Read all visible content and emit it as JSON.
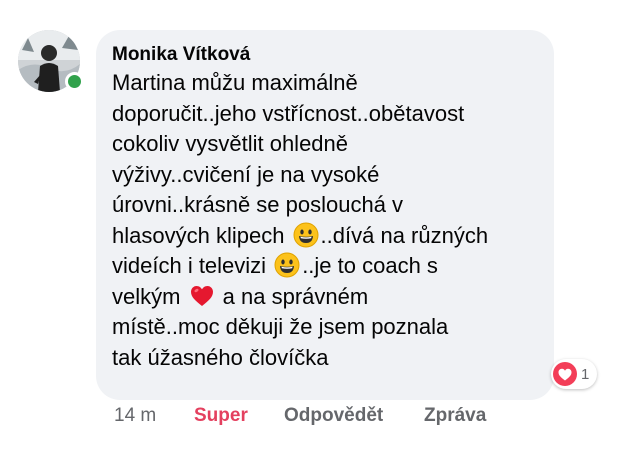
{
  "comment": {
    "author": "Monika Vítková",
    "online": true,
    "body_lines": [
      {
        "text": "Martina můžu maximálně"
      },
      {
        "text": "doporučit..jeho vstřícnost..obětavost"
      },
      {
        "text": "cokoliv vysvětlit ohledně"
      },
      {
        "text": "výživy..cvičení je na vysoké"
      },
      {
        "text": "úrovni..krásně se poslouchá v"
      },
      {
        "before": "hlasových klipech ",
        "emoji": "grinning-face-icon",
        "after": "..dívá na různých"
      },
      {
        "before": "videích i televizi ",
        "emoji": "grinning-face-icon",
        "after": "..je to coach s"
      },
      {
        "before": "velkým ",
        "emoji": "red-heart-icon",
        "after": " a na správném"
      },
      {
        "text": "místě..moc děkuji že jsem poznala"
      },
      {
        "text": "tak úžasného človíčka"
      }
    ]
  },
  "reaction": {
    "icon": "heart-reaction-icon",
    "count": "1",
    "color": "#f33e58"
  },
  "actions": {
    "time": "14 m",
    "like_label": "Super",
    "reply_label": "Odpovědět",
    "message_label": "Zpráva"
  },
  "colors": {
    "bubble": "#f0f2f5",
    "online": "#31a24c",
    "like_active": "#e4405f",
    "secondary_text": "#65676b"
  }
}
